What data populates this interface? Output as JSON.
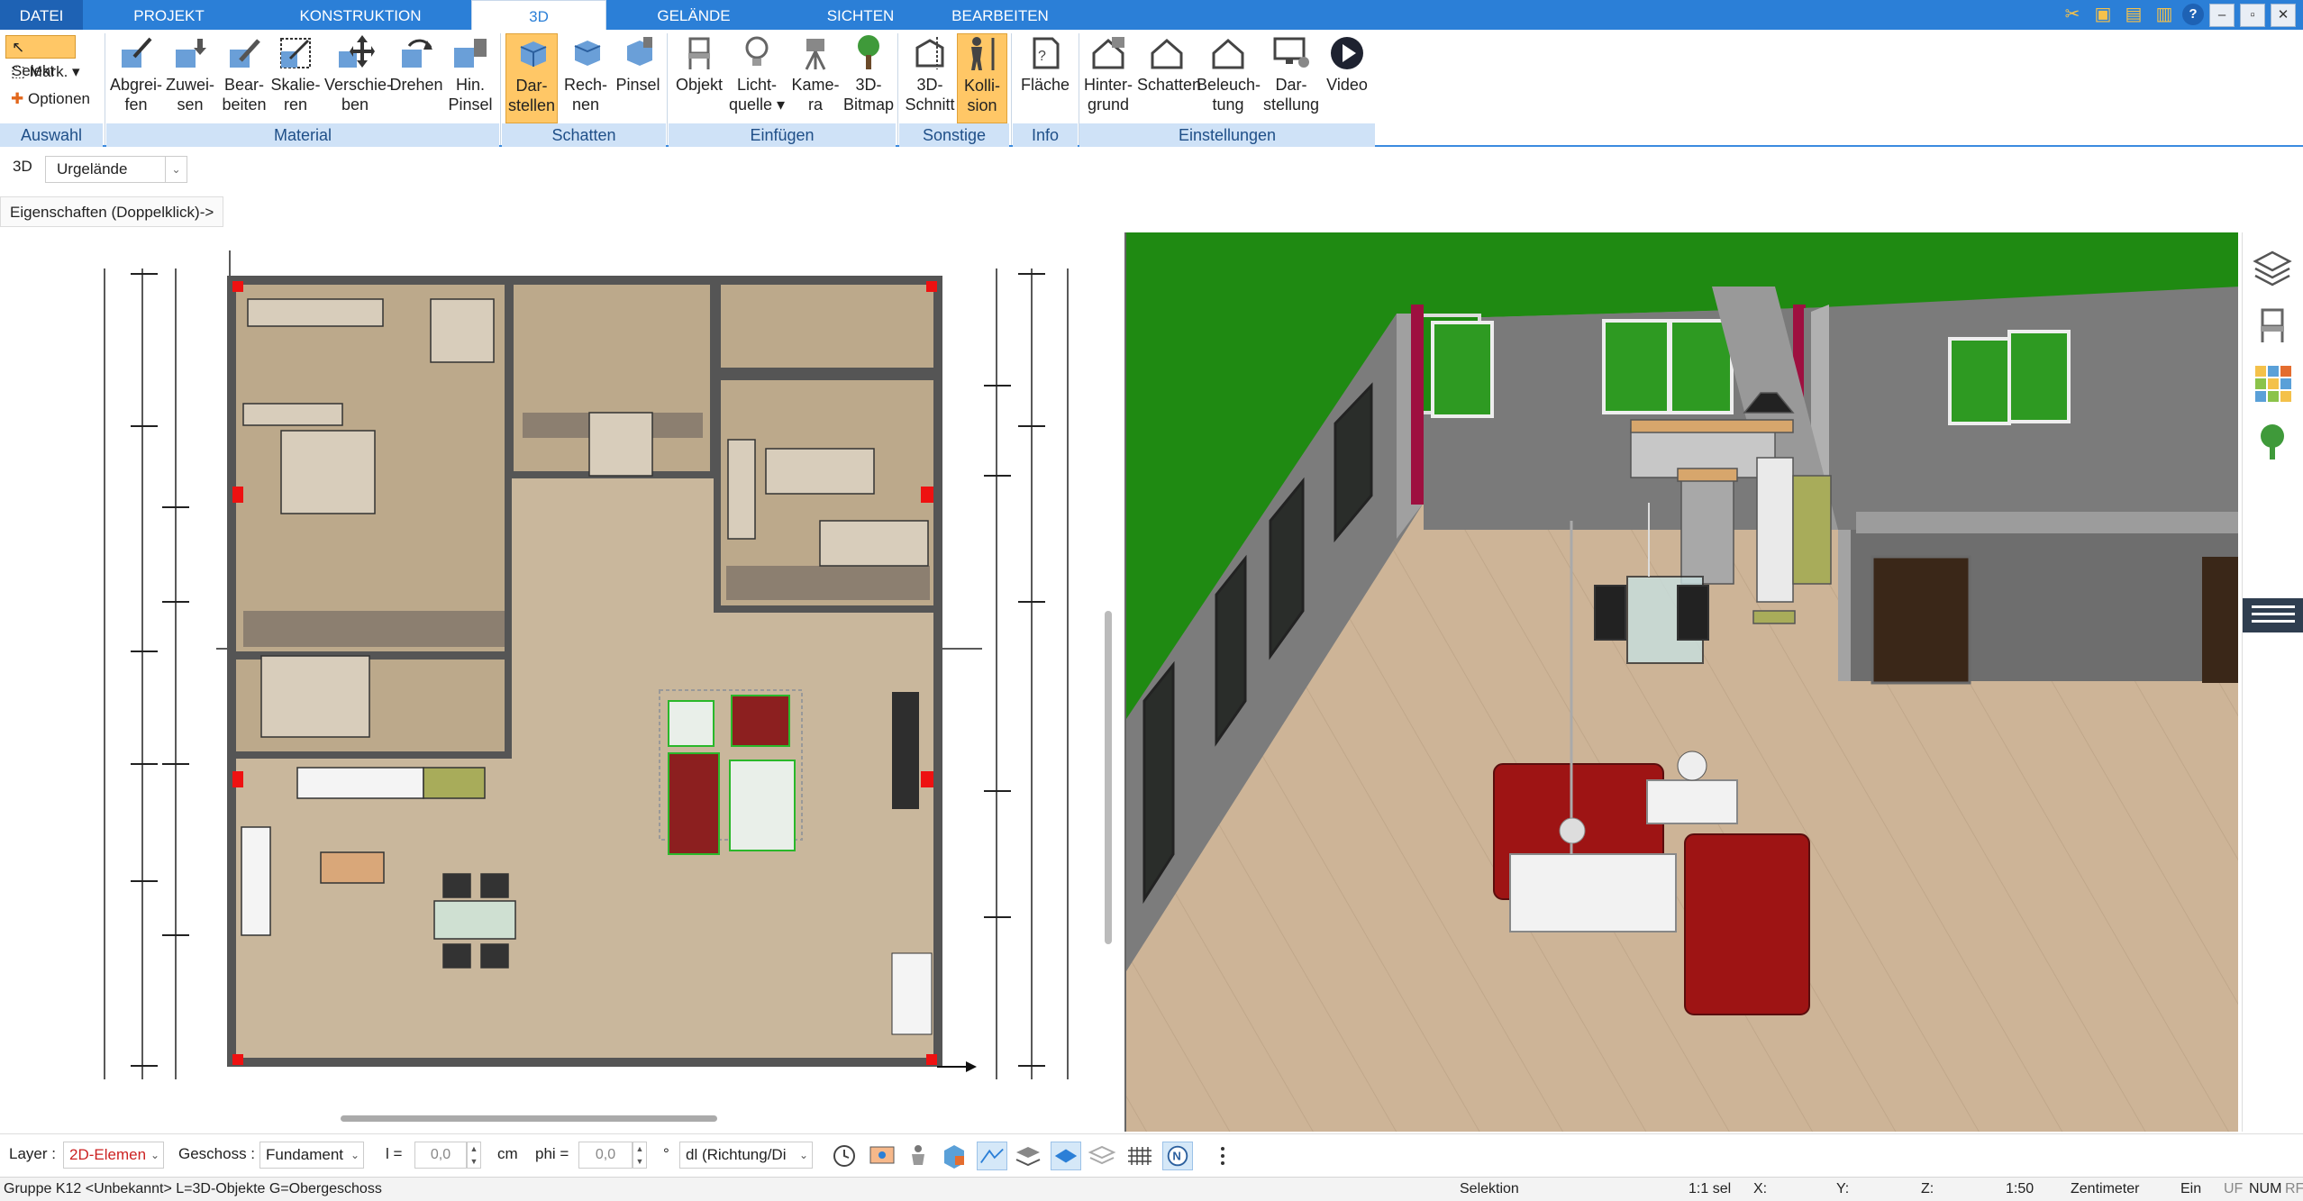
{
  "tabs": [
    {
      "label": "DATEI"
    },
    {
      "label": "PROJEKT"
    },
    {
      "label": "KONSTRUKTION"
    },
    {
      "label": "3D"
    },
    {
      "label": "GELÄNDE"
    },
    {
      "label": "SICHTEN"
    },
    {
      "label": "BEARBEITEN"
    }
  ],
  "ribbon": {
    "auswahl": {
      "selekt": "Selekt",
      "mark": "Mark.",
      "optionen": "Optionen",
      "group": "Auswahl"
    },
    "material": {
      "group": "Material",
      "buttons": [
        {
          "l1": "Abgrei-",
          "l2": "fen"
        },
        {
          "l1": "Zuwei-",
          "l2": "sen"
        },
        {
          "l1": "Bear-",
          "l2": "beiten"
        },
        {
          "l1": "Skalie-",
          "l2": "ren"
        },
        {
          "l1": "Verschie-",
          "l2": "ben"
        },
        {
          "l1": "Drehen",
          "l2": ""
        },
        {
          "l1": "Hin.",
          "l2": "Pinsel"
        }
      ]
    },
    "schatten": {
      "group": "Schatten",
      "buttons": [
        {
          "l1": "Dar-",
          "l2": "stellen"
        },
        {
          "l1": "Rech-",
          "l2": "nen"
        },
        {
          "l1": "Pinsel",
          "l2": ""
        }
      ]
    },
    "einfuegen": {
      "group": "Einfügen",
      "buttons": [
        {
          "l1": "Objekt",
          "l2": ""
        },
        {
          "l1": "Licht-",
          "l2": "quelle"
        },
        {
          "l1": "Kame-",
          "l2": "ra"
        },
        {
          "l1": "3D-",
          "l2": "Bitmap"
        }
      ]
    },
    "sonstige": {
      "group": "Sonstige",
      "buttons": [
        {
          "l1": "3D-",
          "l2": "Schnitt"
        },
        {
          "l1": "Kolli-",
          "l2": "sion"
        }
      ]
    },
    "info": {
      "group": "Info",
      "buttons": [
        {
          "l1": "Fläche",
          "l2": ""
        }
      ]
    },
    "einstellungen": {
      "group": "Einstellungen",
      "buttons": [
        {
          "l1": "Hinter-",
          "l2": "grund"
        },
        {
          "l1": "Schatten",
          "l2": ""
        },
        {
          "l1": "Beleuch-",
          "l2": "tung"
        },
        {
          "l1": "Dar-",
          "l2": "stellung"
        },
        {
          "l1": "Video",
          "l2": ""
        }
      ]
    }
  },
  "viewbar": {
    "mode": "3D",
    "terrain": "Urgelände",
    "properties": "Eigenschaften (Doppelklick)->"
  },
  "bottom": {
    "layer_label": "Layer :",
    "layer_value": "2D-Elemen",
    "geschoss_label": "Geschoss :",
    "geschoss_value": "Fundament",
    "l_label": "l =",
    "l_value": "0,0",
    "l_unit": "cm",
    "phi_label": "phi =",
    "phi_value": "0,0",
    "phi_unit": "°",
    "dl_value": "dl (Richtung/Di"
  },
  "status": {
    "group": "Gruppe K12 <Unbekannt> L=3D-Objekte G=Obergeschoss",
    "mode": "Selektion",
    "sel": "1:1 sel",
    "x": "X:",
    "y": "Y:",
    "z": "Z:",
    "scale": "1:50",
    "unit": "Zentimeter",
    "ein": "Ein",
    "uf": "UF",
    "num": "NUM",
    "rf": "RF"
  },
  "colors": {
    "accent": "#2b7fd7",
    "ribbon_group": "#cfe2f7",
    "selected": "#ffc766",
    "grass": "#1f8a12",
    "floor": "#cdb497"
  }
}
